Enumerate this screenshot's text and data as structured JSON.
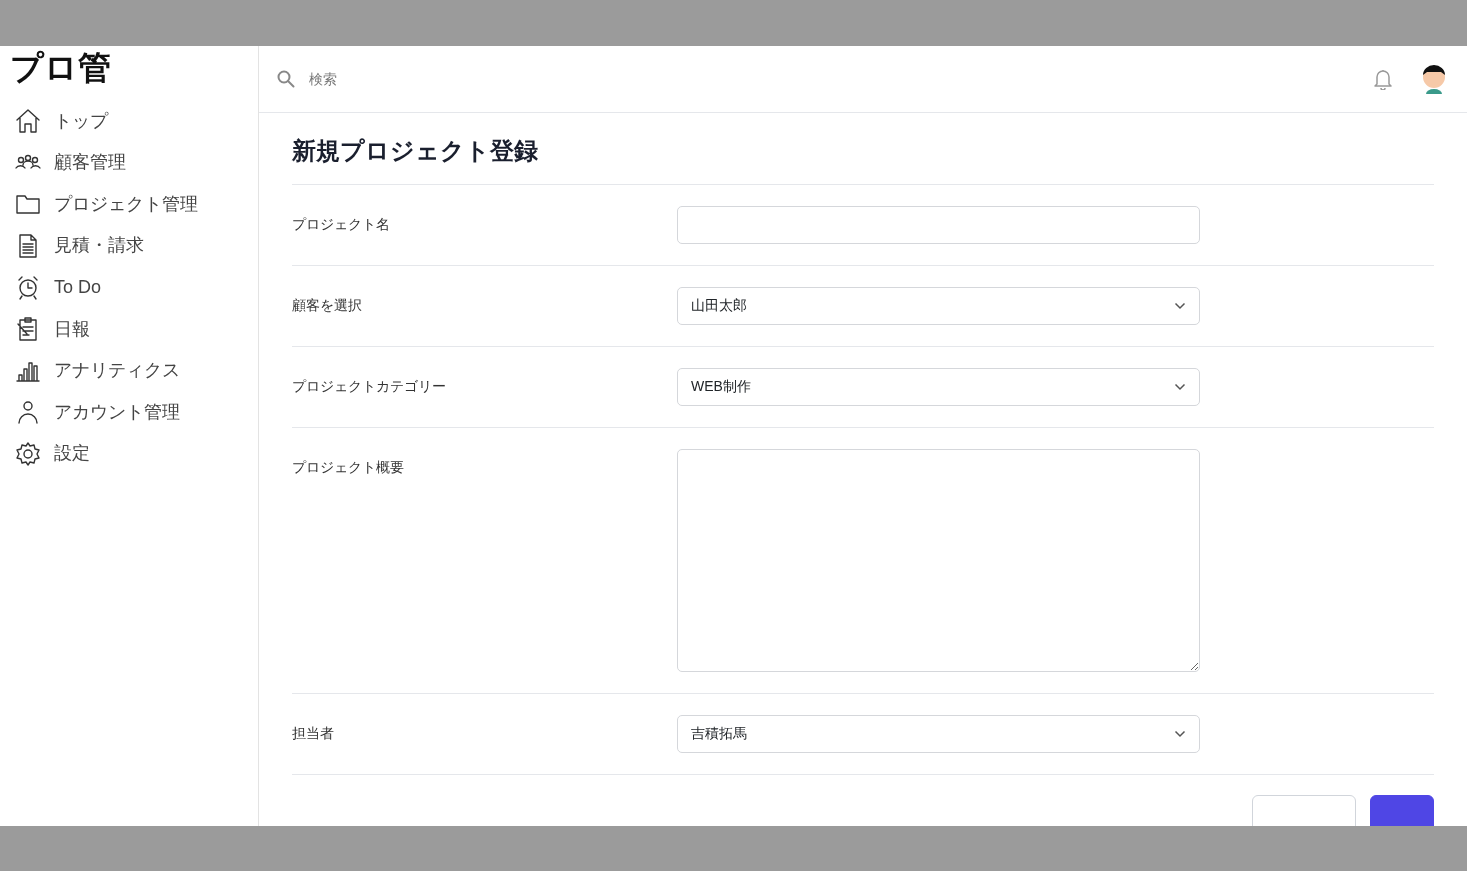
{
  "app": {
    "logo": "プロ管"
  },
  "sidebar": {
    "items": [
      {
        "label": "トップ",
        "kind": "home"
      },
      {
        "label": "顧客管理",
        "kind": "people"
      },
      {
        "label": "プロジェクト管理",
        "kind": "folder"
      },
      {
        "label": "見積・請求",
        "kind": "document"
      },
      {
        "label": "To Do",
        "kind": "clock"
      },
      {
        "label": "日報",
        "kind": "clipboard"
      },
      {
        "label": "アナリティクス",
        "kind": "chart"
      },
      {
        "label": "アカウント管理",
        "kind": "person"
      },
      {
        "label": "設定",
        "kind": "gear"
      }
    ]
  },
  "header": {
    "search": {
      "placeholder": "検索"
    }
  },
  "page": {
    "title": "新規プロジェクト登録"
  },
  "form": {
    "fields": [
      {
        "label": "プロジェクト名",
        "kind": "text"
      },
      {
        "label": "顧客を選択",
        "kind": "select",
        "value": "山田太郎"
      },
      {
        "label": "プロジェクトカテゴリー",
        "kind": "select",
        "value": "WEB制作"
      },
      {
        "label": "プロジェクト概要",
        "kind": "textarea"
      },
      {
        "label": "担当者",
        "kind": "select",
        "value": "吉積拓馬"
      }
    ],
    "buttons": [
      {
        "kind": "secondary"
      },
      {
        "kind": "primary"
      }
    ]
  }
}
